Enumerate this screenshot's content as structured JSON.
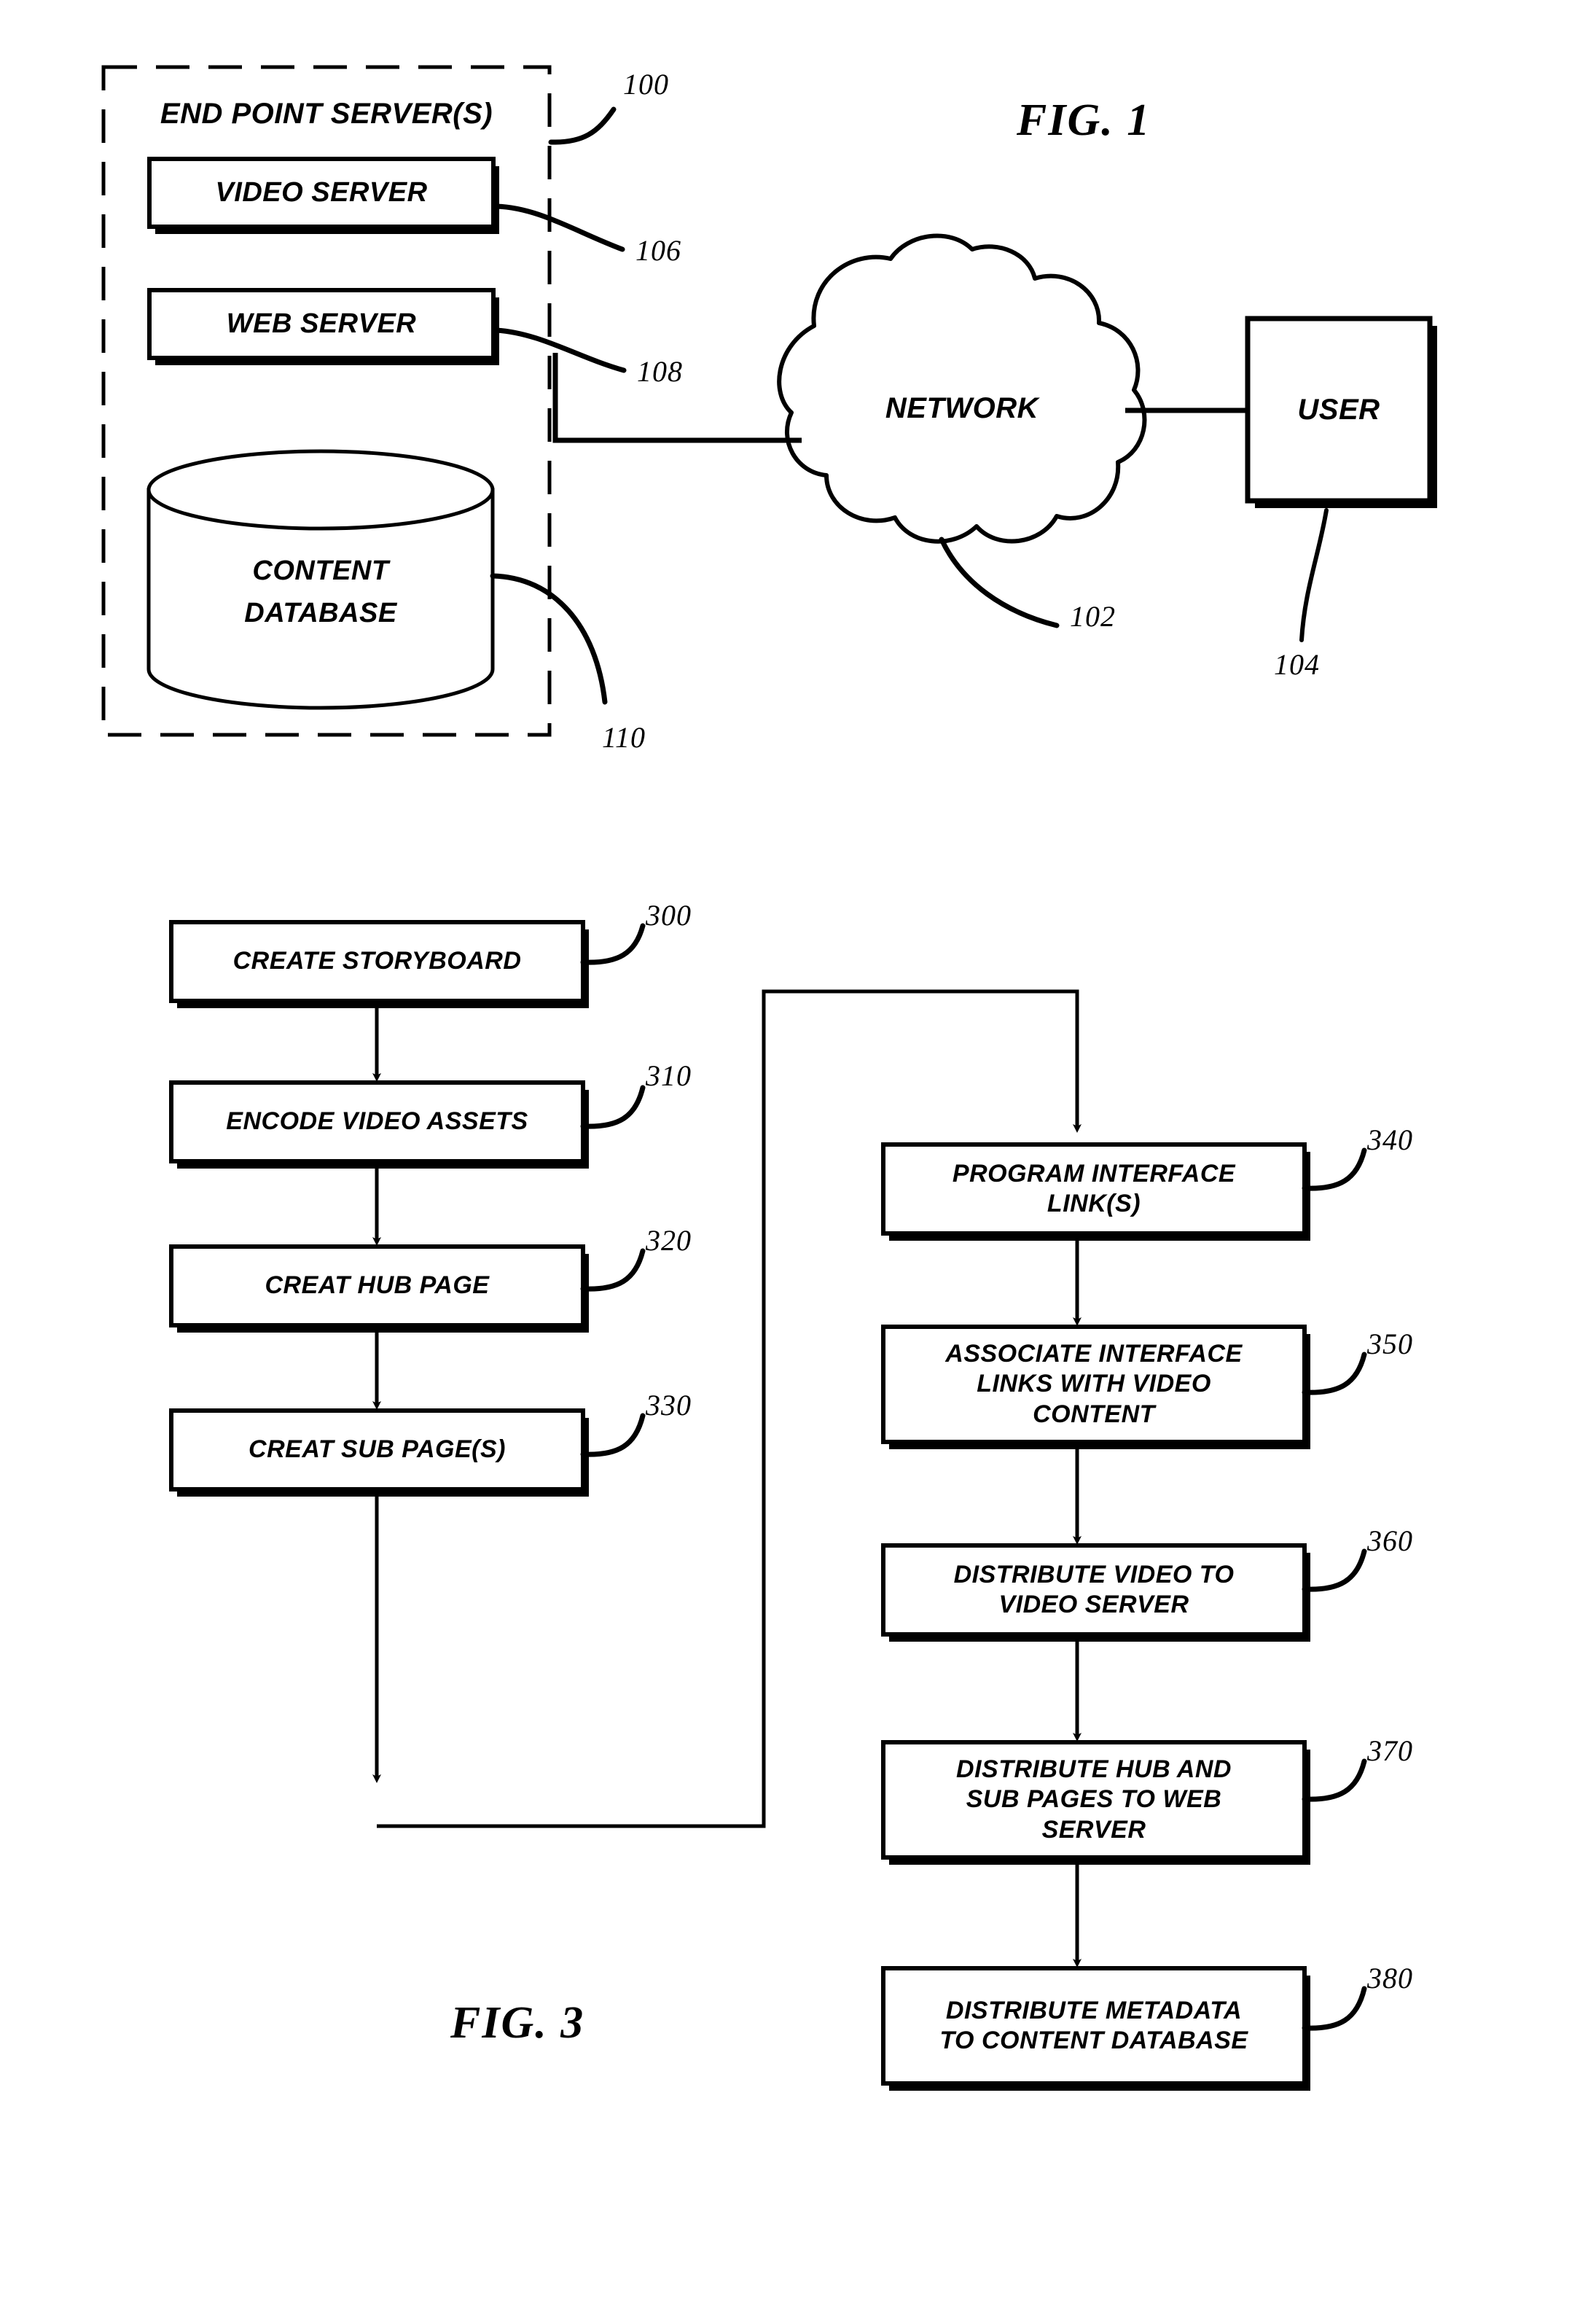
{
  "figures": [
    {
      "id": "fig1",
      "title": "FIG. 1",
      "nodes": {
        "group_label": "END POINT SERVER(S)",
        "video_server": "VIDEO SERVER",
        "web_server": "WEB SERVER",
        "content_database_line1": "CONTENT",
        "content_database_line2": "DATABASE",
        "network": "NETWORK",
        "user": "USER"
      },
      "reference_numerals": {
        "end_point_servers": "100",
        "network": "102",
        "user": "104",
        "video_server": "106",
        "web_server": "108",
        "content_database": "110"
      }
    },
    {
      "id": "fig3",
      "title": "FIG. 3",
      "steps": [
        {
          "ref": "300",
          "label": "CREATE STORYBOARD",
          "lines": [
            "CREATE STORYBOARD"
          ]
        },
        {
          "ref": "310",
          "label": "ENCODE VIDEO ASSETS",
          "lines": [
            "ENCODE VIDEO ASSETS"
          ]
        },
        {
          "ref": "320",
          "label": "CREAT HUB PAGE",
          "lines": [
            "CREAT HUB PAGE"
          ]
        },
        {
          "ref": "330",
          "label": "CREAT SUB PAGE(S)",
          "lines": [
            "CREAT SUB PAGE(S)"
          ]
        },
        {
          "ref": "340",
          "label": "PROGRAM INTERFACE LINK(S)",
          "lines": [
            "PROGRAM INTERFACE",
            "LINK(S)"
          ]
        },
        {
          "ref": "350",
          "label": "ASSOCIATE INTERFACE LINKS WITH VIDEO CONTENT",
          "lines": [
            "ASSOCIATE INTERFACE",
            "LINKS WITH VIDEO",
            "CONTENT"
          ]
        },
        {
          "ref": "360",
          "label": "DISTRIBUTE VIDEO TO VIDEO SERVER",
          "lines": [
            "DISTRIBUTE VIDEO TO",
            "VIDEO SERVER"
          ]
        },
        {
          "ref": "370",
          "label": "DISTRIBUTE HUB AND SUB PAGES TO WEB SERVER",
          "lines": [
            "DISTRIBUTE HUB AND",
            "SUB PAGES TO WEB",
            "SERVER"
          ]
        },
        {
          "ref": "380",
          "label": "DISTRIBUTE METADATA TO CONTENT DATABASE",
          "lines": [
            "DISTRIBUTE METADATA",
            "TO CONTENT DATABASE"
          ]
        }
      ]
    }
  ],
  "colors": {
    "ink": "#000000",
    "paper": "#ffffff"
  }
}
